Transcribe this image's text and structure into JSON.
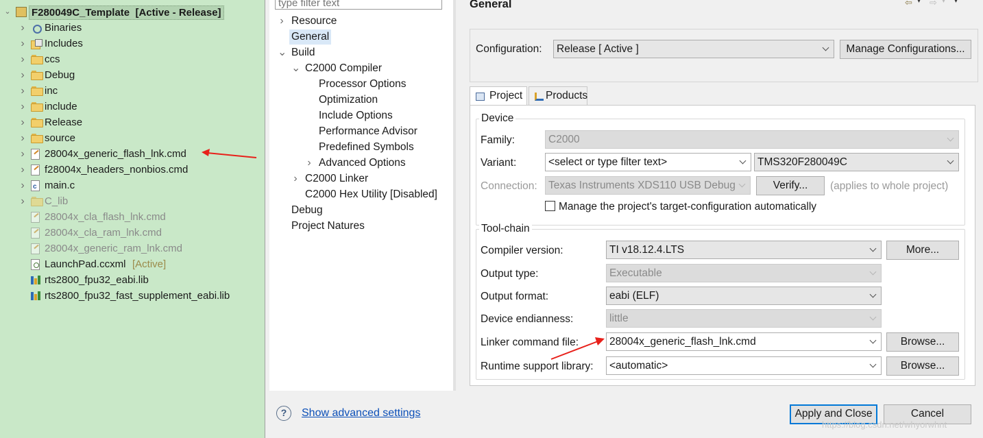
{
  "explorer": {
    "project": {
      "name": "F280049C_Template",
      "tag": "[Active - Release]"
    },
    "items": [
      {
        "label": "Binaries",
        "kind": "binaries",
        "expandable": true,
        "dim": false
      },
      {
        "label": "Includes",
        "kind": "includes",
        "expandable": true,
        "dim": false
      },
      {
        "label": "ccs",
        "kind": "folder",
        "expandable": true,
        "dim": false
      },
      {
        "label": "Debug",
        "kind": "folder",
        "expandable": true,
        "dim": false
      },
      {
        "label": "inc",
        "kind": "folder",
        "expandable": true,
        "dim": false
      },
      {
        "label": "include",
        "kind": "folder",
        "expandable": true,
        "dim": false
      },
      {
        "label": "Release",
        "kind": "folder",
        "expandable": true,
        "dim": false
      },
      {
        "label": "source",
        "kind": "folder",
        "expandable": true,
        "dim": false
      },
      {
        "label": "28004x_generic_flash_lnk.cmd",
        "kind": "cmd",
        "expandable": true,
        "dim": false
      },
      {
        "label": "f28004x_headers_nonbios.cmd",
        "kind": "cmd",
        "expandable": true,
        "dim": false
      },
      {
        "label": "main.c",
        "kind": "c",
        "expandable": true,
        "dim": false
      },
      {
        "label": "C_lib",
        "kind": "folder-excluded",
        "expandable": true,
        "dim": true
      },
      {
        "label": "28004x_cla_flash_lnk.cmd",
        "kind": "cmd",
        "expandable": false,
        "dim": true
      },
      {
        "label": "28004x_cla_ram_lnk.cmd",
        "kind": "cmd",
        "expandable": false,
        "dim": true
      },
      {
        "label": "28004x_generic_ram_lnk.cmd",
        "kind": "cmd",
        "expandable": false,
        "dim": true
      },
      {
        "label": "LaunchPad.ccxml",
        "kind": "xml",
        "expandable": false,
        "dim": false,
        "tag": "[Active]"
      },
      {
        "label": "rts2800_fpu32_eabi.lib",
        "kind": "lib",
        "expandable": false,
        "dim": false
      },
      {
        "label": "rts2800_fpu32_fast_supplement_eabi.lib",
        "kind": "lib",
        "expandable": false,
        "dim": false
      }
    ]
  },
  "props_tree": {
    "filter_placeholder": "type filter text",
    "nodes": [
      {
        "label": "Resource",
        "arrow": "right",
        "level": 0,
        "selected": false
      },
      {
        "label": "General",
        "arrow": "",
        "level": 0,
        "selected": true
      },
      {
        "label": "Build",
        "arrow": "down",
        "level": 0,
        "selected": false
      },
      {
        "label": "C2000 Compiler",
        "arrow": "down",
        "level": 1,
        "selected": false
      },
      {
        "label": "Processor Options",
        "arrow": "",
        "level": 2,
        "selected": false
      },
      {
        "label": "Optimization",
        "arrow": "",
        "level": 2,
        "selected": false
      },
      {
        "label": "Include Options",
        "arrow": "",
        "level": 2,
        "selected": false
      },
      {
        "label": "Performance Advisor",
        "arrow": "",
        "level": 2,
        "selected": false
      },
      {
        "label": "Predefined Symbols",
        "arrow": "",
        "level": 2,
        "selected": false
      },
      {
        "label": "Advanced Options",
        "arrow": "right",
        "level": 2,
        "selected": false
      },
      {
        "label": "C2000 Linker",
        "arrow": "right",
        "level": 1,
        "selected": false
      },
      {
        "label": "C2000 Hex Utility  [Disabled]",
        "arrow": "",
        "level": 1,
        "selected": false
      },
      {
        "label": "Debug",
        "arrow": "",
        "level": 0,
        "selected": false
      },
      {
        "label": "Project Natures",
        "arrow": "",
        "level": 0,
        "selected": false
      }
    ]
  },
  "general": {
    "title": "General",
    "configuration_label": "Configuration:",
    "configuration_value": "Release  [ Active ]",
    "manage_button": "Manage Configurations...",
    "tabs": [
      {
        "label": "Project",
        "active": true
      },
      {
        "label": "Products",
        "active": false
      }
    ],
    "device": {
      "group_title": "Device",
      "family_label": "Family:",
      "family_value": "C2000",
      "variant_label": "Variant:",
      "variant_filter": "<select or type filter text>",
      "variant_value": "TMS320F280049C",
      "connection_label": "Connection:",
      "connection_value": "Texas Instruments XDS110 USB Debug",
      "verify_button": "Verify...",
      "applies_note": "(applies to whole project)",
      "manage_checkbox": "Manage the project's target-configuration automatically"
    },
    "toolchain": {
      "group_title": "Tool-chain",
      "compiler_label": "Compiler version:",
      "compiler_value": "TI v18.12.4.LTS",
      "more_button": "More...",
      "output_type_label": "Output type:",
      "output_type_value": "Executable",
      "output_format_label": "Output format:",
      "output_format_value": "eabi (ELF)",
      "endianness_label": "Device endianness:",
      "endianness_value": "little",
      "linker_label": "Linker command file:",
      "linker_value": "28004x_generic_flash_lnk.cmd",
      "runtime_label": "Runtime support library:",
      "runtime_value": "<automatic>",
      "browse_button": "Browse..."
    }
  },
  "footer": {
    "advanced_link": "Show advanced settings",
    "apply_close": "Apply and Close",
    "cancel": "Cancel",
    "watermark": "https://blog.csdn.net/whyorwhnt"
  },
  "colors": {
    "explorer_bg": "#c9e8c8",
    "selection": "#d9e8f7",
    "annotation_arrow": "#e8201a",
    "link": "#0b4fb8",
    "primary_border": "#0078d7"
  }
}
